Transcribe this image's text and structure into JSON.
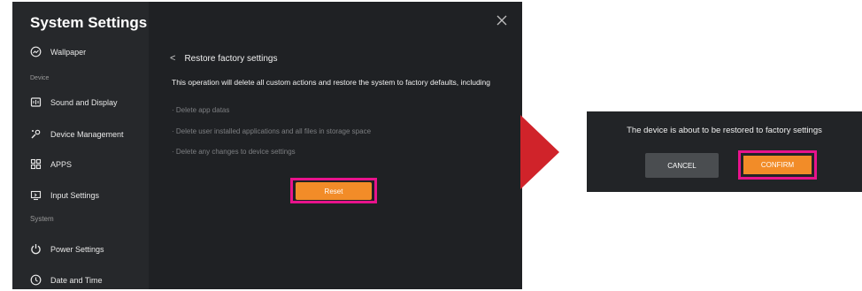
{
  "settings": {
    "title": "System Settings",
    "section_device": "Device",
    "section_system": "System",
    "items": [
      {
        "label": "Wallpaper",
        "icon": "wallpaper-icon"
      },
      {
        "label": "Sound and Display",
        "icon": "display-icon"
      },
      {
        "label": "Device Management",
        "icon": "device-management-icon"
      },
      {
        "label": "APPS",
        "icon": "apps-icon"
      },
      {
        "label": "Input Settings",
        "icon": "input-icon"
      },
      {
        "label": "Power Settings",
        "icon": "power-icon"
      },
      {
        "label": "Date and Time",
        "icon": "clock-icon"
      }
    ]
  },
  "restore": {
    "back_label": "Restore factory settings",
    "description": "This operation will delete all custom actions and restore the system to factory defaults, including",
    "bullets": [
      "· Delete app datas",
      "· Delete user installed applications and all files in storage space",
      "· Delete any changes to device settings"
    ],
    "reset_label": "Reset"
  },
  "dialog": {
    "message": "The device is about to be restored to factory settings",
    "cancel_label": "CANCEL",
    "confirm_label": "CONFIRM"
  },
  "colors": {
    "accent": "#f28c28",
    "highlight": "#e8138c",
    "arrow": "#d0232a",
    "panel": "#1f2124"
  }
}
